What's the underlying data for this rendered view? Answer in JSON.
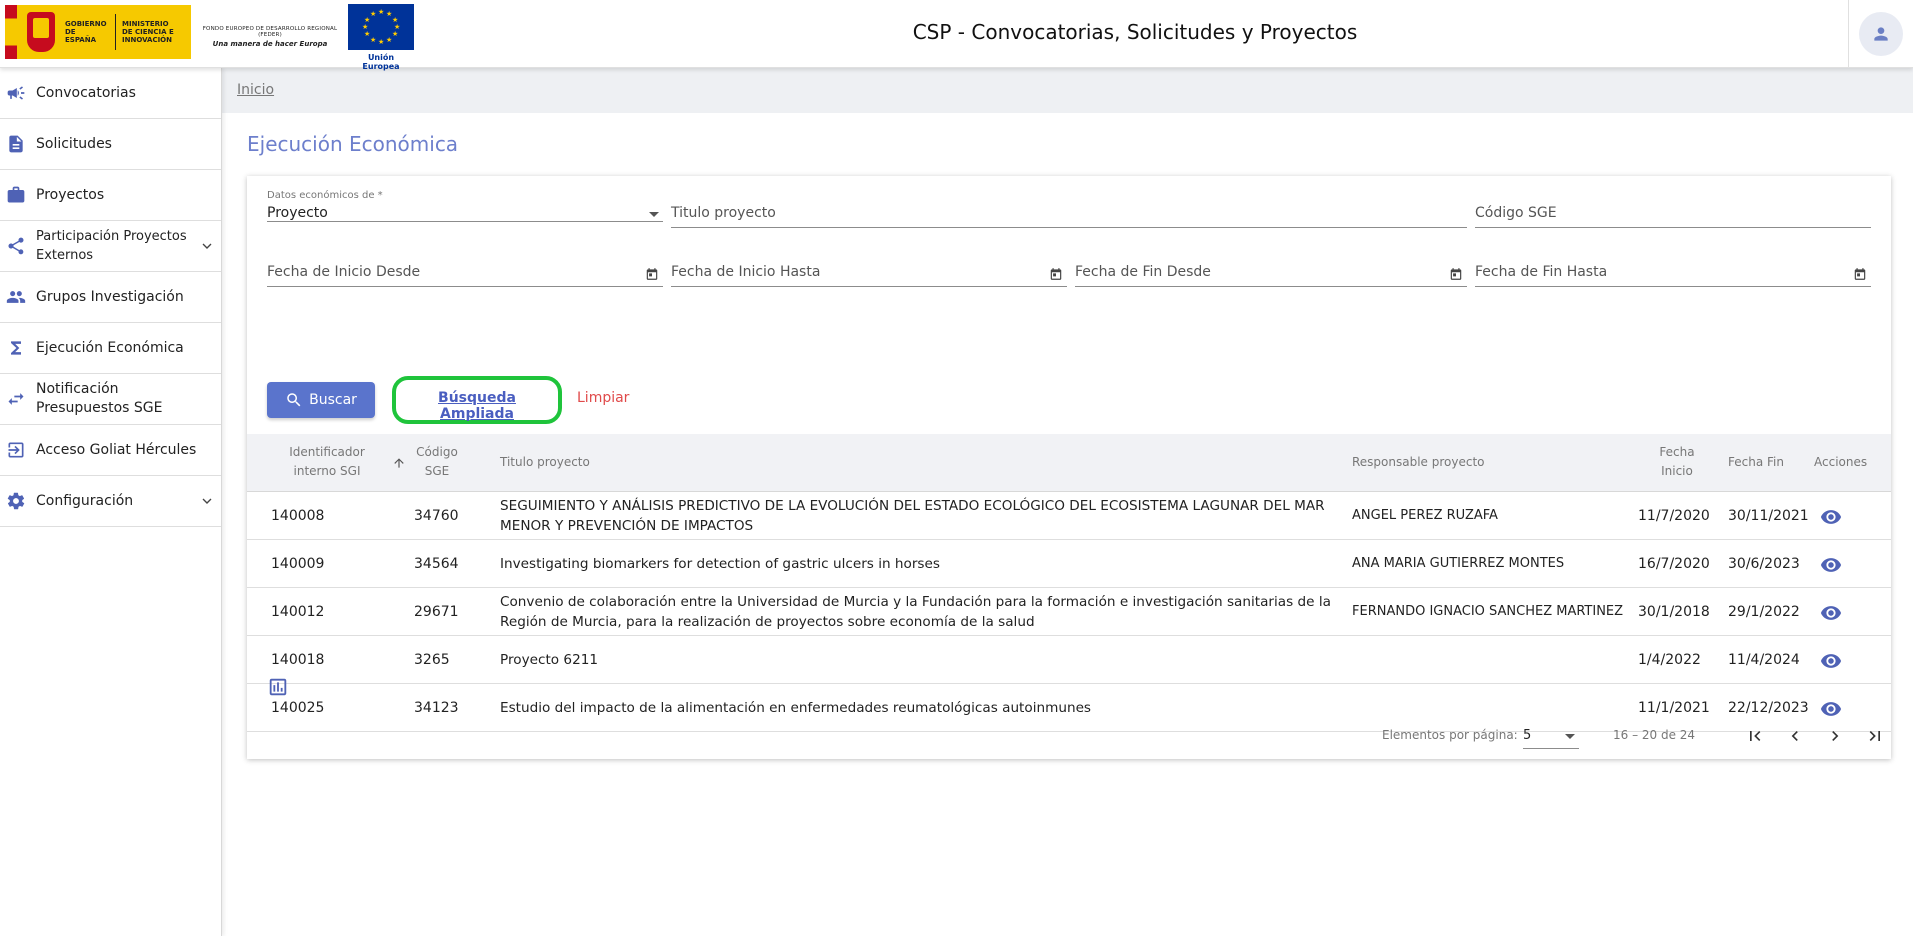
{
  "header": {
    "title": "CSP - Convocatorias, Solicitudes y Proyectos",
    "logo_gobierno_text": "GOBIERNO DE ESPAÑA",
    "logo_ministerio_text": "MINISTERIO DE CIENCIA E INNOVACIÓN",
    "feder_line1": "FONDO EUROPEO DE DESARROLLO REGIONAL (FEDER)",
    "feder_line2": "Una manera de hacer Europa",
    "eu_caption": "Unión Europea",
    "user_icon": "person-icon"
  },
  "sidebar": {
    "items": [
      {
        "label": "Convocatorias",
        "icon": "megaphone-icon"
      },
      {
        "label": "Solicitudes",
        "icon": "document-icon"
      },
      {
        "label": "Proyectos",
        "icon": "briefcase-icon"
      },
      {
        "label": "Participación Proyectos Externos",
        "icon": "share-icon"
      },
      {
        "label": "Grupos Investigación",
        "icon": "group-icon"
      },
      {
        "label": "Ejecución Económica",
        "icon": "sigma-icon"
      },
      {
        "label": "Notificación Presupuestos SGE",
        "icon": "swap-icon"
      },
      {
        "label": "Acceso Goliat Hércules",
        "icon": "login-icon"
      },
      {
        "label": "Configuración",
        "icon": "gear-icon"
      }
    ]
  },
  "breadcrumb": {
    "home": "Inicio"
  },
  "page": {
    "title": "Ejecución Económica"
  },
  "filters": {
    "datos_label": "Datos económicos de *",
    "datos_value": "Proyecto",
    "titulo_placeholder": "Titulo proyecto",
    "codigo_placeholder": "Código SGE",
    "fecha_inicio_desde": "Fecha de Inicio Desde",
    "fecha_inicio_hasta": "Fecha de Inicio Hasta",
    "fecha_fin_desde": "Fecha de Fin Desde",
    "fecha_fin_hasta": "Fecha de Fin Hasta"
  },
  "actions": {
    "buscar": "Buscar",
    "busqueda_ampliada": "Búsqueda Ampliada",
    "limpiar": "Limpiar"
  },
  "table": {
    "headers": {
      "id_line1": "Identificador",
      "id_line2": "interno SGI",
      "codigo_line1": "Código",
      "codigo_line2": "SGE",
      "titulo": "Titulo proyecto",
      "responsable": "Responsable proyecto",
      "fecha_inicio_line1": "Fecha",
      "fecha_inicio_line2": "Inicio",
      "fecha_fin": "Fecha Fin",
      "acciones": "Acciones"
    },
    "rows": [
      {
        "id": "140008",
        "codigo": "34760",
        "titulo": "SEGUIMIENTO Y ANÁLISIS PREDICTIVO DE LA EVOLUCIÓN DEL ESTADO ECOLÓGICO DEL ECOSISTEMA LAGUNAR DEL MAR MENOR Y PREVENCIÓN DE IMPACTOS",
        "responsable": "ANGEL PEREZ RUZAFA",
        "inicio": "11/7/2020",
        "fin": "30/11/2021"
      },
      {
        "id": "140009",
        "codigo": "34564",
        "titulo": "Investigating biomarkers for detection of gastric ulcers in horses",
        "responsable": "ANA MARIA GUTIERREZ MONTES",
        "inicio": "16/7/2020",
        "fin": "30/6/2023"
      },
      {
        "id": "140012",
        "codigo": "29671",
        "titulo": "Convenio de colaboración entre la Universidad de Murcia y la Fundación para la formación e investigación sanitarias de la Región de Murcia, para la realización de proyectos sobre economía de la salud",
        "responsable": "FERNANDO IGNACIO SANCHEZ MARTINEZ",
        "inicio": "30/1/2018",
        "fin": "29/1/2022"
      },
      {
        "id": "140018",
        "codigo": "3265",
        "titulo": "Proyecto 6211",
        "responsable": "",
        "inicio": "1/4/2022",
        "fin": "11/4/2024"
      },
      {
        "id": "140025",
        "codigo": "34123",
        "titulo": "Estudio del impacto de la alimentación en enfermedades reumatológicas autoinmunes",
        "responsable": "",
        "inicio": "11/1/2021",
        "fin": "22/12/2023"
      }
    ]
  },
  "paginator": {
    "label": "Elementos por página:",
    "page_size": "5",
    "range": "16 – 20 de 24"
  },
  "colors": {
    "accent": "#5a74cc",
    "title": "#6d7fcc",
    "highlight": "#1fc43b",
    "danger": "#e04a4a"
  }
}
